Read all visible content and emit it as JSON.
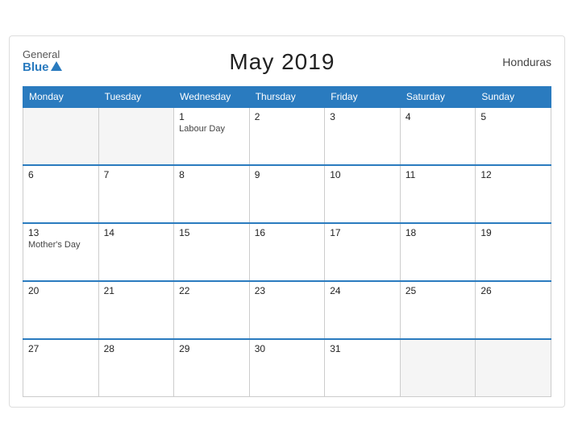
{
  "header": {
    "logo_general": "General",
    "logo_blue": "Blue",
    "title": "May 2019",
    "country": "Honduras"
  },
  "days_of_week": [
    "Monday",
    "Tuesday",
    "Wednesday",
    "Thursday",
    "Friday",
    "Saturday",
    "Sunday"
  ],
  "weeks": [
    [
      {
        "day": "",
        "empty": true
      },
      {
        "day": "",
        "empty": true
      },
      {
        "day": "1",
        "event": "Labour Day"
      },
      {
        "day": "2",
        "event": ""
      },
      {
        "day": "3",
        "event": ""
      },
      {
        "day": "4",
        "event": ""
      },
      {
        "day": "5",
        "event": ""
      }
    ],
    [
      {
        "day": "6",
        "event": ""
      },
      {
        "day": "7",
        "event": ""
      },
      {
        "day": "8",
        "event": ""
      },
      {
        "day": "9",
        "event": ""
      },
      {
        "day": "10",
        "event": ""
      },
      {
        "day": "11",
        "event": ""
      },
      {
        "day": "12",
        "event": ""
      }
    ],
    [
      {
        "day": "13",
        "event": "Mother's Day"
      },
      {
        "day": "14",
        "event": ""
      },
      {
        "day": "15",
        "event": ""
      },
      {
        "day": "16",
        "event": ""
      },
      {
        "day": "17",
        "event": ""
      },
      {
        "day": "18",
        "event": ""
      },
      {
        "day": "19",
        "event": ""
      }
    ],
    [
      {
        "day": "20",
        "event": ""
      },
      {
        "day": "21",
        "event": ""
      },
      {
        "day": "22",
        "event": ""
      },
      {
        "day": "23",
        "event": ""
      },
      {
        "day": "24",
        "event": ""
      },
      {
        "day": "25",
        "event": ""
      },
      {
        "day": "26",
        "event": ""
      }
    ],
    [
      {
        "day": "27",
        "event": ""
      },
      {
        "day": "28",
        "event": ""
      },
      {
        "day": "29",
        "event": ""
      },
      {
        "day": "30",
        "event": ""
      },
      {
        "day": "31",
        "event": ""
      },
      {
        "day": "",
        "empty": true
      },
      {
        "day": "",
        "empty": true
      }
    ]
  ]
}
